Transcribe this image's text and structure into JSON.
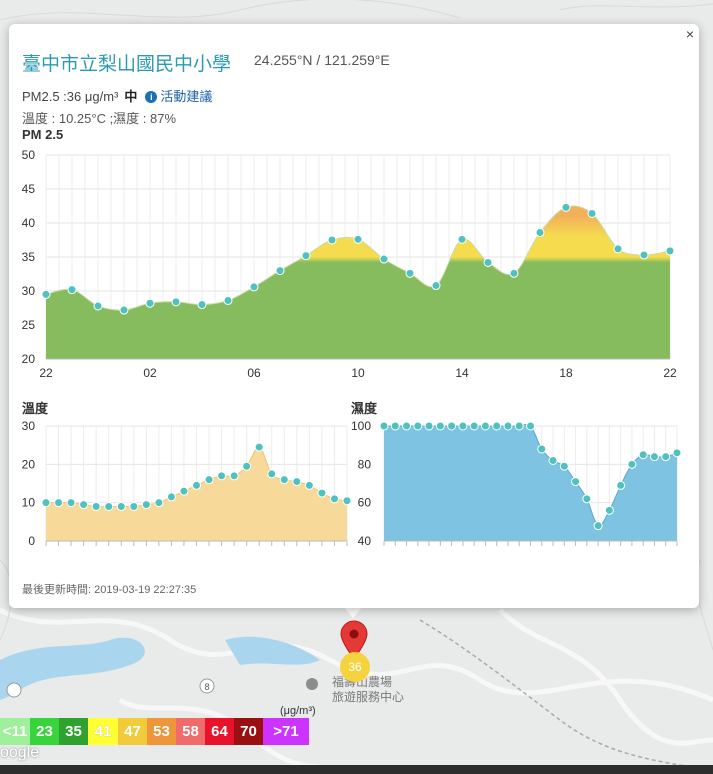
{
  "popup": {
    "close_label": "×",
    "title": "臺中市立梨山國民中小學",
    "coords": "24.255°N / 121.259°E",
    "pm_reading": "PM2.5 :36 μg/m³",
    "level": "中",
    "info_icon": "i",
    "advice_link": "活動建議",
    "weather": "溫度 : 10.25°C ;濕度 : 87%",
    "updated": "最後更新時間: 2019-03-19 22:27:35"
  },
  "chart_data": [
    {
      "type": "area",
      "title": "PM 2.5",
      "x_ticks": [
        "22",
        "02",
        "06",
        "10",
        "14",
        "18",
        "22"
      ],
      "ylim": [
        20,
        50
      ],
      "y_ticks": [
        20,
        25,
        30,
        35,
        40,
        45,
        50
      ],
      "values": [
        29.5,
        30.2,
        27.8,
        27.2,
        28.2,
        28.4,
        28.0,
        28.6,
        30.6,
        33.0,
        35.2,
        37.5,
        37.6,
        34.7,
        32.6,
        30.8,
        37.6,
        34.2,
        32.6,
        38.6,
        42.3,
        41.4,
        36.2,
        35.3,
        35.9
      ],
      "colors": {
        "good": "#86bb5e",
        "moderate": "#f5dc4f",
        "high": "#f2b05a",
        "point": "#4fc1be"
      }
    },
    {
      "type": "area",
      "title": "溫度",
      "ylim": [
        0,
        30
      ],
      "y_ticks": [
        0,
        10,
        20,
        30
      ],
      "values": [
        10,
        10,
        10,
        9.5,
        9,
        9,
        9,
        9,
        9.5,
        10,
        11.5,
        13,
        14.5,
        16,
        17,
        17,
        19.5,
        24.5,
        17.5,
        16,
        15.5,
        14.5,
        12.5,
        11,
        10.5
      ],
      "colors": {
        "fill": "#f7d99a",
        "point": "#4fc1be"
      }
    },
    {
      "type": "area",
      "title": "濕度",
      "ylim": [
        40,
        100
      ],
      "y_ticks": [
        40,
        60,
        80,
        100
      ],
      "values": [
        100,
        100,
        100,
        100,
        100,
        100,
        100,
        100,
        100,
        100,
        100,
        100,
        100,
        100,
        88,
        82,
        79,
        71,
        62,
        48,
        56,
        69,
        80,
        85,
        84,
        84,
        86
      ],
      "colors": {
        "fill": "#7ec3e2",
        "point": "#4fc1be"
      }
    }
  ],
  "legend": {
    "unit": "(μg/m³)",
    "items": [
      {
        "label": "<11",
        "color": "#9ff09a"
      },
      {
        "label": "23",
        "color": "#37d43b"
      },
      {
        "label": "35",
        "color": "#2ea12e"
      },
      {
        "label": "41",
        "color": "#ffff33"
      },
      {
        "label": "47",
        "color": "#f2cb3a"
      },
      {
        "label": "53",
        "color": "#f0963a"
      },
      {
        "label": "58",
        "color": "#f06b6b"
      },
      {
        "label": "64",
        "color": "#e8122a"
      },
      {
        "label": "70",
        "color": "#9a0f12"
      },
      {
        "label": ">71",
        "color": "#cc33ff"
      }
    ]
  },
  "map": {
    "place_label_1": "福壽山農場",
    "place_label_2": "旅遊服務中心",
    "road_label": "8",
    "marker_value": "36",
    "attribution": "oogle"
  }
}
